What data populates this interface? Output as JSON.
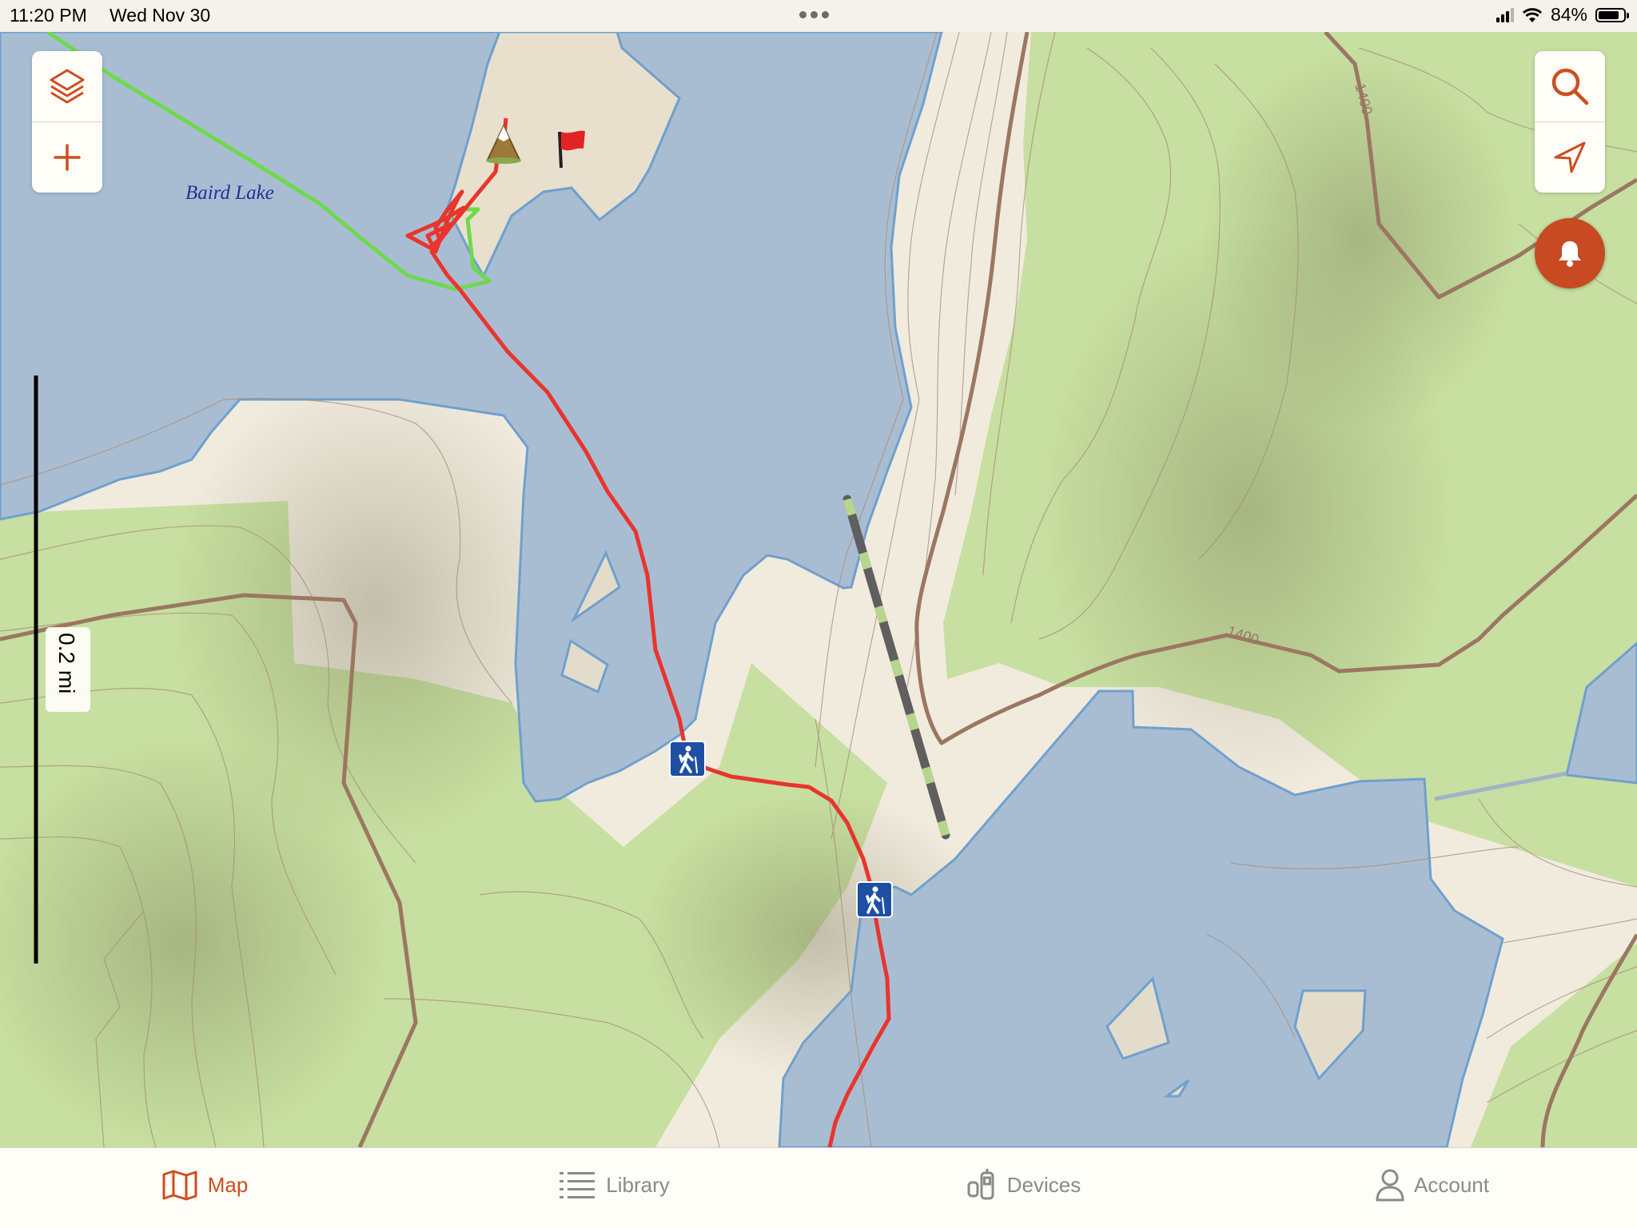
{
  "status_bar": {
    "time": "11:20 PM",
    "date": "Wed Nov 30",
    "battery": "84%",
    "battery_level": 0.84
  },
  "map": {
    "lake_label": "Baird Lake",
    "contour_labels": [
      "1400",
      "1400"
    ],
    "scale_label": "0.2 mi",
    "markers": [
      {
        "icon": "mountain-peak-icon"
      },
      {
        "icon": "flag-icon"
      },
      {
        "icon": "hiker-icon"
      },
      {
        "icon": "hiker-icon"
      }
    ],
    "colors": {
      "water": "#a9bdd2",
      "water_edge": "#6fa0cf",
      "vegetation": "#c5dd9f",
      "land": "#f1ebde",
      "index_contour": "#9b7762",
      "red_track": "#e8352d",
      "green_track": "#6fd94d",
      "accent": "#cf4d1f"
    }
  },
  "controls": {
    "left": [
      "layers-icon",
      "plus-icon"
    ],
    "right": [
      "search-icon",
      "navigation-arrow-icon"
    ],
    "alert": "bell-icon"
  },
  "tabs": [
    {
      "label": "Map",
      "icon": "map-icon",
      "active": true
    },
    {
      "label": "Library",
      "icon": "list-icon",
      "active": false
    },
    {
      "label": "Devices",
      "icon": "devices-icon",
      "active": false
    },
    {
      "label": "Account",
      "icon": "person-icon",
      "active": false
    }
  ]
}
